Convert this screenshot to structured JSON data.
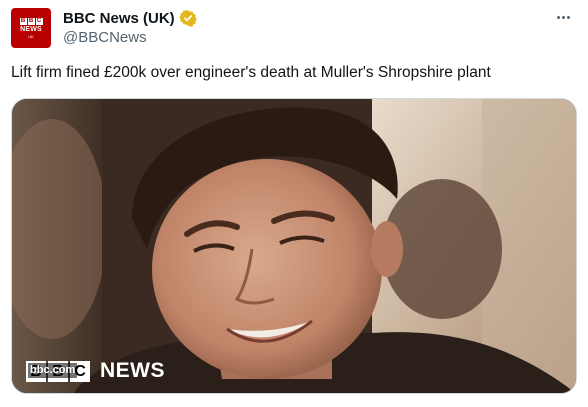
{
  "account": {
    "name": "BBC News (UK)",
    "handle": "@BBCNews",
    "avatar_blocks": [
      "B",
      "B",
      "C"
    ],
    "avatar_word": "NEWS",
    "avatar_region": "UK",
    "verified_icon": "verified-badge-gold",
    "verified_color": "#e2b719"
  },
  "more_icon": "more-horizontal-icon",
  "tweet_text": "Lift firm fined £200k over engineer's death at Muller's Shropshire plant",
  "media": {
    "watermark_site": "bbc.com",
    "watermark_blocks": [
      "B",
      "B",
      "C"
    ],
    "watermark_word": "NEWS"
  },
  "colors": {
    "brand_red": "#b80000",
    "text_primary": "#0f1419",
    "text_secondary": "#536471"
  }
}
